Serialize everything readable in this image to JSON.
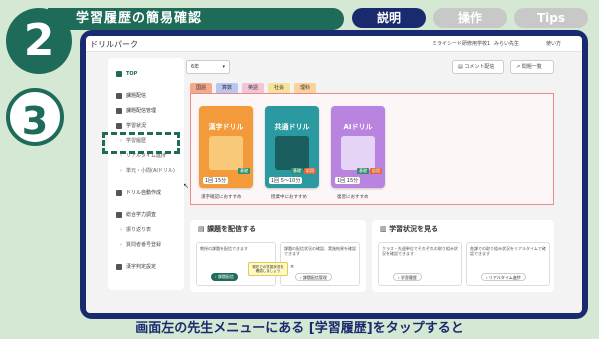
{
  "banner": {
    "title": "学習履歴の簡易確認",
    "tabs": [
      {
        "label": "説明",
        "active": true
      },
      {
        "label": "操作",
        "active": false
      },
      {
        "label": "Tips",
        "active": false
      }
    ],
    "step_main": "2",
    "step_sub": "3",
    "accent": "#1e6b5a",
    "navy": "#1a2a6e"
  },
  "app": {
    "logo": "ドリルパーク",
    "school": "ミライシード研修用学校1",
    "user": "みらい先生",
    "help": "使い方"
  },
  "sidebar": {
    "items": [
      {
        "label": "TOP",
        "icon": "home-icon"
      },
      {
        "label": "課題配信",
        "icon": "assign-icon"
      },
      {
        "label": "課題配信管理",
        "icon": "manage-icon"
      },
      {
        "label": "学習状況",
        "icon": "chart-icon"
      },
      {
        "label": "学習履歴",
        "sub": true
      },
      {
        "label": "リアルタイム進捗",
        "sub": true
      },
      {
        "label": "単元・小問(AIドリル)",
        "sub": true
      },
      {
        "label": "ドリル自動作成",
        "icon": "pencil-icon"
      },
      {
        "label": "総合学力調査",
        "icon": "survey-icon"
      },
      {
        "label": "振り返り表",
        "sub": true
      },
      {
        "label": "質問者番号登録",
        "sub": true
      },
      {
        "label": "漢字判定設定",
        "icon": "check-icon"
      }
    ]
  },
  "main": {
    "grade": "6年",
    "comment_btn": "コメント配信",
    "questions_btn": "問題一覧",
    "subjects": [
      {
        "label": "国語",
        "color": "#f4a98a"
      },
      {
        "label": "算数",
        "color": "#b9c6f2"
      },
      {
        "label": "英語",
        "color": "#f2c4d6"
      },
      {
        "label": "社会",
        "color": "#f5e29b"
      },
      {
        "label": "理科",
        "color": "#fbd29a"
      }
    ],
    "drills": [
      {
        "title": "漢字ドリル",
        "meta": "1回 15分",
        "tags": [
          "基礎"
        ],
        "bg": "#f39a3a",
        "img": "#f8c978",
        "caption": "漢字確認におすすめ"
      },
      {
        "title": "共通ドリル",
        "meta": "1回 5〜10分",
        "tags": [
          "基礎",
          "応用"
        ],
        "bg": "#2a9aa0",
        "img": "#1b5e60",
        "caption": "授業中におすすめ"
      },
      {
        "title": "AIドリル",
        "meta": "1回 15分",
        "tags": [
          "基礎",
          "応用"
        ],
        "bg": "#b884e0",
        "img": "#e6d4f6",
        "caption": "復習におすすめ"
      }
    ]
  },
  "panels": {
    "left": {
      "title": "課題を配信する",
      "card1_text": "教授の課題を配信できます",
      "card1_btn": "課題配信",
      "card2_text": "課題の配信状況の確認、実施結果を確認できます",
      "card2_btn": "課題配信管理",
      "tooltip": "現在での学習状況を確認しましょう"
    },
    "right": {
      "title": "学習状況を見る",
      "card1_text": "クラス・先週単位でそれぞれの取り組み状況を確認できます",
      "card1_btn": "学習履歴",
      "card2_text": "各課での取り組み状況をリアルタイムで確認できます",
      "card2_btn": "リアルタイム進捗"
    }
  },
  "subtitle": "画面左の先生メニューにある [学習履歴]をタップすると"
}
